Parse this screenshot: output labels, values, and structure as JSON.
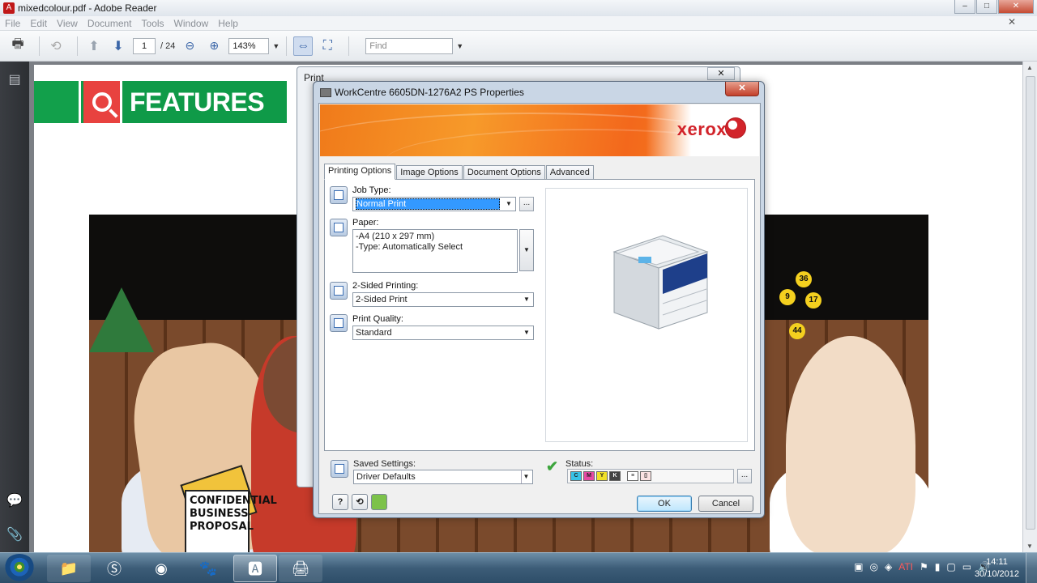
{
  "window": {
    "title": "mixedcolour.pdf - Adobe Reader",
    "min": "–",
    "max": "□",
    "close": "✕"
  },
  "menu": {
    "items": [
      "File",
      "Edit",
      "View",
      "Document",
      "Tools",
      "Window",
      "Help"
    ],
    "close": "✕"
  },
  "toolbar": {
    "page_current": "1",
    "page_total": "/ 24",
    "zoom": "143%",
    "find_placeholder": "Find"
  },
  "pdf": {
    "banner_text": "FEATURES",
    "confidential_text": "CONFIDENTIAL BUSINESS PROPOSAL",
    "numbers": [
      "36",
      "9",
      "17",
      "44"
    ]
  },
  "print_dialog": {
    "title": "Print",
    "close": "✕"
  },
  "properties": {
    "title": "WorkCentre 6605DN-1276A2 PS Properties",
    "close": "✕",
    "brand": "xerox",
    "tabs": [
      "Printing Options",
      "Image Options",
      "Document Options",
      "Advanced"
    ],
    "job_type_label": "Job Type:",
    "job_type_value": "Normal Print",
    "paper_label": "Paper:",
    "paper_line1": "-A4 (210 x 297 mm)",
    "paper_line2": "-Type: Automatically Select",
    "two_sided_label": "2-Sided Printing:",
    "two_sided_value": "2-Sided Print",
    "quality_label": "Print Quality:",
    "quality_value": "Standard",
    "saved_label": "Saved Settings:",
    "saved_value": "Driver Defaults",
    "status_label": "Status:",
    "toner": [
      "C",
      "M",
      "Y",
      "K"
    ],
    "more": "...",
    "help_btn": "?",
    "ok": "OK",
    "cancel": "Cancel"
  },
  "taskbar": {
    "time": "14:11",
    "date": "30/10/2012"
  }
}
